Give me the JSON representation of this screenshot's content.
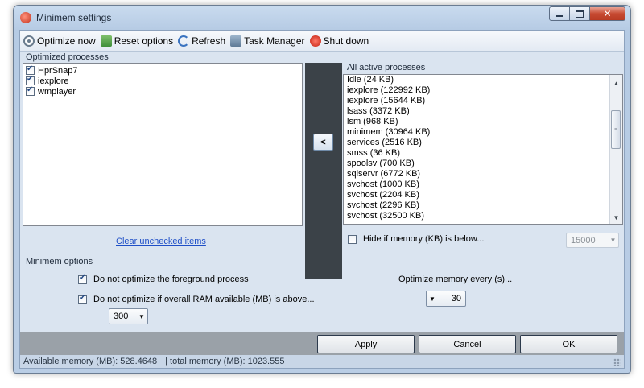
{
  "window": {
    "title": "Minimem settings"
  },
  "toolbar": {
    "items": [
      {
        "label": "Optimize now",
        "icon": "optimize-icon"
      },
      {
        "label": "Reset options",
        "icon": "reset-icon"
      },
      {
        "label": "Refresh",
        "icon": "refresh-icon"
      },
      {
        "label": "Task Manager",
        "icon": "task-manager-icon"
      },
      {
        "label": "Shut down",
        "icon": "shut-down-icon"
      }
    ]
  },
  "optimized": {
    "label": "Optimized processes",
    "items": [
      {
        "name": "HprSnap7",
        "checked": true
      },
      {
        "name": "iexplore",
        "checked": true
      },
      {
        "name": "wmplayer",
        "checked": true
      }
    ],
    "clear_link": "Clear unchecked items"
  },
  "move_button": "<",
  "active": {
    "label": "All active processes",
    "items": [
      "Idle (24 KB)",
      "iexplore (122992 KB)",
      "iexplore (15644 KB)",
      "lsass (3372 KB)",
      "lsm (968 KB)",
      "minimem (30964 KB)",
      "services (2516 KB)",
      "smss (36 KB)",
      "spoolsv (700 KB)",
      "sqlservr (6772 KB)",
      "svchost (1000 KB)",
      "svchost (2204 KB)",
      "svchost (2296 KB)",
      "svchost (32500 KB)"
    ],
    "hide_label": "Hide if memory (KB) is below...",
    "hide_checked": false,
    "hide_value": "15000"
  },
  "options": {
    "label": "Minimem options",
    "foreground_label": "Do not optimize the foreground process",
    "foreground_checked": true,
    "ram_label": "Do not optimize if overall RAM available (MB) is above...",
    "ram_checked": true,
    "ram_value": "300",
    "every_label": "Optimize memory every (s)...",
    "every_value": "30"
  },
  "buttons": {
    "apply": "Apply",
    "cancel": "Cancel",
    "ok": "OK"
  },
  "status": {
    "available": "Available memory (MB): 528.4648",
    "total": "|  total memory (MB): 1023.555"
  }
}
